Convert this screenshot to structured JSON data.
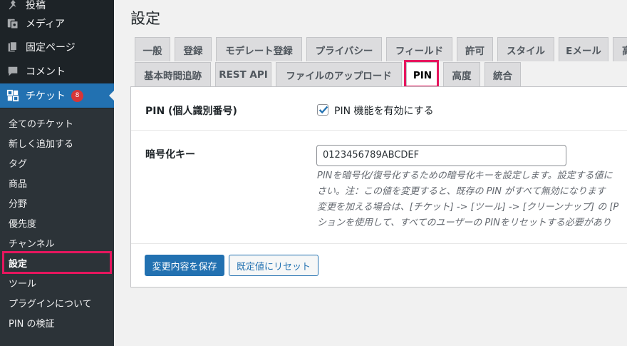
{
  "sidebar": {
    "menu": [
      {
        "label": "投稿",
        "icon": "pin-icon"
      },
      {
        "label": "メディア",
        "icon": "media-icon"
      },
      {
        "label": "固定ページ",
        "icon": "page-icon"
      },
      {
        "label": "コメント",
        "icon": "comment-icon"
      },
      {
        "label": "チケット",
        "icon": "grid-icon",
        "badge": "8"
      }
    ],
    "submenu": [
      "全てのチケット",
      "新しく追加する",
      "タグ",
      "商品",
      "分野",
      "優先度",
      "チャンネル",
      "設定",
      "ツール",
      "プラグインについて",
      "PIN の検証"
    ],
    "current_submenu": "設定"
  },
  "page": {
    "title": "設定",
    "tabs_row1": [
      "一般",
      "登録",
      "モデレート登録",
      "プライバシー",
      "フィールド",
      "許可",
      "スタイル",
      "Eメール",
      "高"
    ],
    "tabs_row2": [
      "基本時間追跡",
      "REST API",
      "ファイルのアップロード",
      "PIN",
      "高度",
      "統合"
    ],
    "active_tab": "PIN"
  },
  "form": {
    "pin_row": {
      "label": "PIN (個人識別番号)",
      "checkbox_label": "PIN 機能を有効にする",
      "checked": true
    },
    "key_row": {
      "label": "暗号化キー",
      "value": "0123456789ABCDEF",
      "description": [
        "PINを暗号化/復号化するための暗号化キーを設定します。設定する値に",
        "さい。注：この値を変更すると、既存の PIN がすべて無効になります",
        "変更を加える場合は、[チケット] -> [ツール] -> [クリーンナップ] の [P",
        "ションを使用して、すべてのユーザーの PINをリセットする必要があり"
      ]
    },
    "save_label": "変更内容を保存",
    "reset_label": "既定値にリセット"
  },
  "colors": {
    "accent": "#2271b1",
    "highlight": "#e6165e",
    "sidebar_bg": "#1d2327",
    "submenu_bg": "#2c3338"
  }
}
